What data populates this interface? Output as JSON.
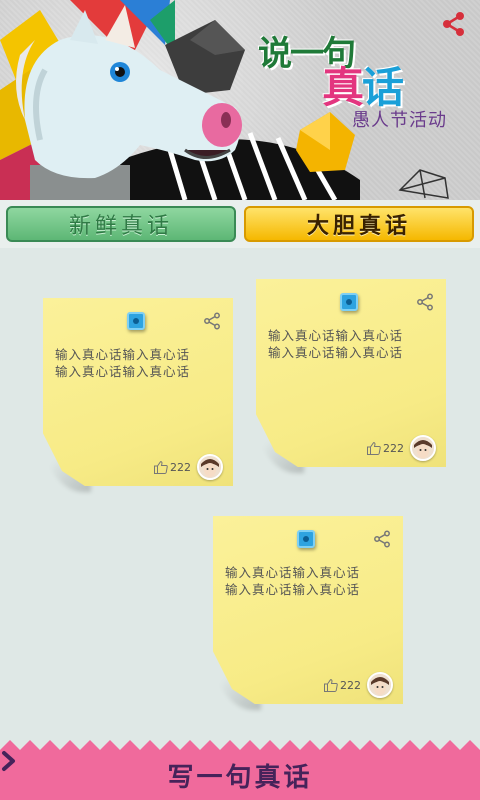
{
  "banner": {
    "title_line1": "说一句",
    "title_line2_a": "真",
    "title_line2_b": "话",
    "subtitle": "愚人节活动",
    "share_icon": "share-icon"
  },
  "tabs": [
    {
      "label": "新鲜真话",
      "active": false
    },
    {
      "label": "大胆真话",
      "active": true
    }
  ],
  "notes": [
    {
      "lines": [
        "输入真心话输入真心话",
        "输入真心话输入真心话"
      ],
      "likes": "222"
    },
    {
      "lines": [
        "输入真心话输入真心话",
        "输入真心话输入真心话"
      ],
      "likes": "222"
    },
    {
      "lines": [
        "输入真心话输入真心话",
        "输入真心话输入真心话"
      ],
      "likes": "222"
    }
  ],
  "bottom": {
    "cta_label": "写一句真话",
    "cta_icon": "chevron-right-icon"
  },
  "colors": {
    "background": "#dfe8e6",
    "note": "#f7eb86",
    "bottom_bar": "#f06a9c",
    "tab_fresh": "#6cc384",
    "tab_bold": "#f5c400"
  }
}
